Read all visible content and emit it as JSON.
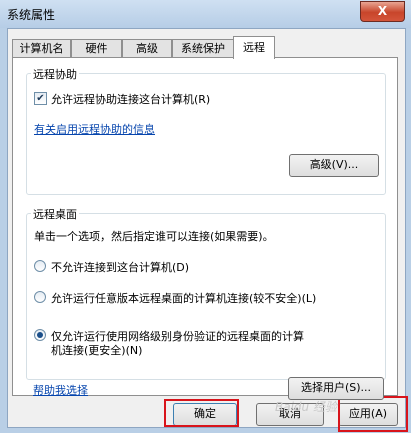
{
  "window": {
    "title": "系统属性",
    "close_label": "X"
  },
  "tabs": [
    {
      "label": "计算机名",
      "active": false
    },
    {
      "label": "硬件",
      "active": false
    },
    {
      "label": "高级",
      "active": false
    },
    {
      "label": "系统保护",
      "active": false
    },
    {
      "label": "远程",
      "active": true
    }
  ],
  "remote_assistance": {
    "title": "远程协助",
    "allow_label": "允许远程协助连接这台计算机(R)",
    "allow_checked": true,
    "info_link": "有关启用远程协助的信息",
    "advanced_button": "高级(V)..."
  },
  "remote_desktop": {
    "title": "远程桌面",
    "instruction": "单击一个选项，然后指定谁可以连接(如果需要)。",
    "options": [
      {
        "label": "不允许连接到这台计算机(D)",
        "checked": false
      },
      {
        "label": "允许运行任意版本远程桌面的计算机连接(较不安全)(L)",
        "checked": false
      },
      {
        "label": "仅允许运行使用网络级别身份验证的远程桌面的计算机连接(更安全)(N)",
        "line1": "仅允许运行使用网络级别身份验证的远程桌面的计算",
        "line2": "机连接(更安全)(N)",
        "checked": true
      }
    ],
    "help_link": "帮助我选择",
    "select_users_button": "选择用户(S)..."
  },
  "footer": {
    "ok": "确定",
    "cancel": "取消",
    "apply": "应用(A)"
  },
  "watermark": "Baidu 经验"
}
